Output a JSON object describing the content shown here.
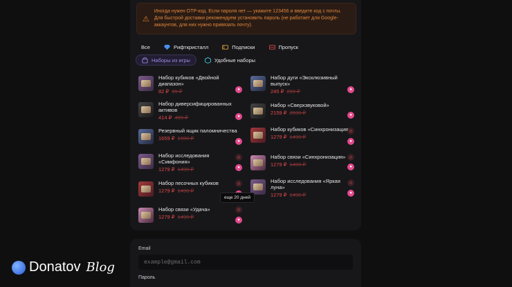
{
  "warning": {
    "text": "Иногда нужен OTP-код. Если пароля нет — укажите 123456 и введите код с почты. Для быстрой доставки рекомендуем установить пароль (не работает для Google-аккаунтов, для них нужно привязать почту)."
  },
  "tabs": [
    {
      "label": "Все",
      "icon": "none"
    },
    {
      "label": "Рифткристалл",
      "icon": "diamond-icon"
    },
    {
      "label": "Подписки",
      "icon": "ticket-icon"
    },
    {
      "label": "Пропуск",
      "icon": "pass-icon"
    }
  ],
  "tabs2": [
    {
      "label": "Наборы из игры",
      "icon": "bag-icon",
      "active": true
    },
    {
      "label": "Удобные наборы",
      "icon": "box-icon",
      "active": false
    }
  ],
  "items_left": [
    {
      "name": "Набор кубиков «Двойной диапазон»",
      "price": "82 ₽",
      "old": "99 ₽",
      "action": "add"
    },
    {
      "name": "Набор диверсифицированных активов",
      "price": "414 ₽",
      "old": "499 ₽",
      "action": "add"
    },
    {
      "name": "Резервный ящик паломничества",
      "price": "1659 ₽",
      "old": "1990 ₽",
      "action": "add"
    },
    {
      "name": "Набор исследования «Симфония»",
      "price": "1279 ₽",
      "old": "1490 ₽",
      "action": "add"
    },
    {
      "name": "Набор песочных кубиков",
      "price": "1279 ₽",
      "old": "1490 ₽",
      "action": "add"
    },
    {
      "name": "Набор связи «Удача»",
      "price": "1279 ₽",
      "old": "1490 ₽",
      "action": "add"
    }
  ],
  "items_right": [
    {
      "name": "Набор дуги «Эксклюзивный выпуск»",
      "price": "245 ₽",
      "old": "299 ₽",
      "action": "add"
    },
    {
      "name": "Набор «Сверхзвуковой»",
      "price": "2159 ₽",
      "old": "2590 ₽",
      "action": "add"
    },
    {
      "name": "Набор кубиков «Синхронизация»",
      "price": "1279 ₽",
      "old": "1490 ₽",
      "action": "add"
    },
    {
      "name": "Набор связи «Синхронизация»",
      "price": "1279 ₽",
      "old": "1490 ₽",
      "action": "add"
    },
    {
      "name": "Набор исследования «Яркая луна»",
      "price": "1279 ₽",
      "old": "1490 ₽",
      "action": "add"
    }
  ],
  "tooltip": "еще 20 дней",
  "form": {
    "email_label": "Email",
    "email_placeholder": "example@gmail.com",
    "password_label": "Пароль"
  },
  "brand": {
    "name": "Donatov",
    "suffix": "Blog"
  },
  "colors": {
    "accent": "#e24a8c",
    "price": "#e24a4a",
    "warning": "#e0863d",
    "active_tab": "#9b8ce0"
  }
}
